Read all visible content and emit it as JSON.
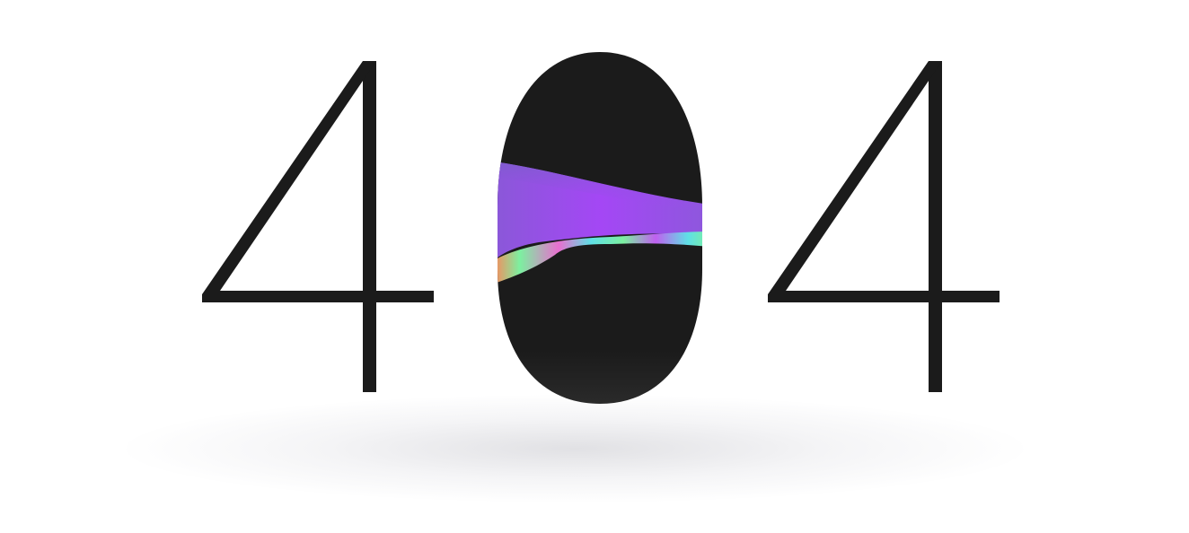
{
  "error": {
    "code": "404",
    "digits": [
      "4",
      "0",
      "4"
    ]
  },
  "colors": {
    "glyph": "#1b1b1b",
    "background": "#ffffff",
    "wave_purple": "#a447f5",
    "wave_violet": "#7a55d6",
    "wave_cyan": "#5fe0e6",
    "wave_green": "#7cf0a0",
    "wave_orange": "#f88a5c"
  }
}
